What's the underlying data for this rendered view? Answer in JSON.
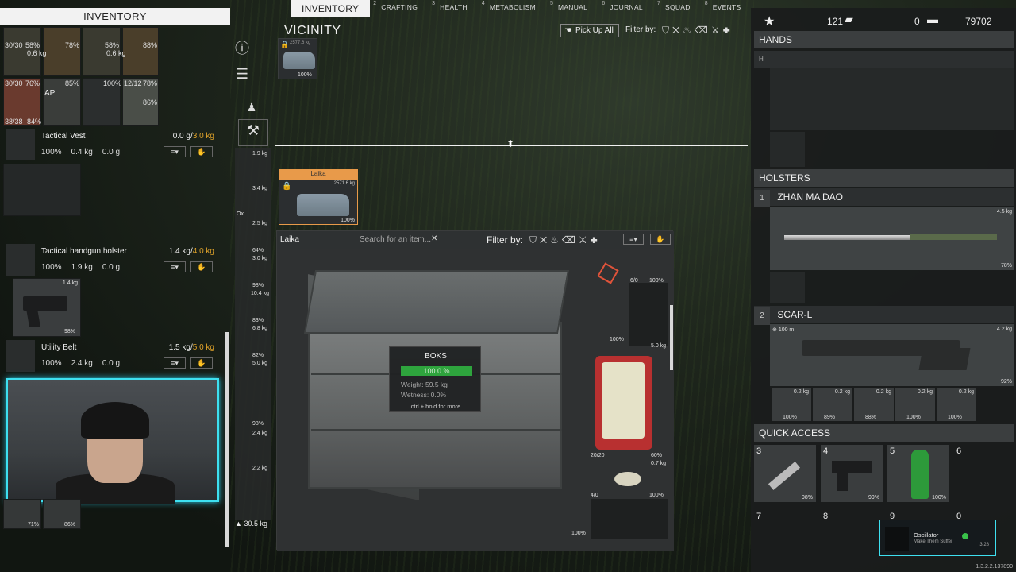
{
  "tabs": [
    {
      "num": "",
      "label": "INVENTORY",
      "active": true
    },
    {
      "num": "2",
      "label": "CRAFTING"
    },
    {
      "num": "3",
      "label": "HEALTH"
    },
    {
      "num": "4",
      "label": "METABOLISM"
    },
    {
      "num": "5",
      "label": "MANUAL"
    },
    {
      "num": "6",
      "label": "JOURNAL"
    },
    {
      "num": "7",
      "label": "SQUAD"
    },
    {
      "num": "8",
      "label": "EVENTS"
    }
  ],
  "inventory": {
    "title": "INVENTORY",
    "top_stack_labels": [
      "30/30",
      "58%",
      "78%",
      "58%",
      "88%",
      "0.6 kg",
      "0.6 kg",
      "30/30",
      "76%",
      "85%",
      "100%",
      "78%",
      "12/12",
      "86%",
      "AP",
      "38/38",
      "84%"
    ],
    "tactical_vest": {
      "name": "Tactical Vest",
      "weight": "0.0 g/",
      "capacity": "3.0 kg",
      "condition": "100%",
      "w1": "0.4 kg",
      "w2": "0.0 g"
    },
    "holster": {
      "name": "Tactical handgun holster",
      "weight": "1.4 kg/",
      "capacity": "4.0 kg",
      "condition": "100%",
      "w1": "1.9 kg",
      "w2": "0.0 g",
      "pistol_weight": "1.4 kg",
      "pistol_pct": "98%"
    },
    "utility_belt": {
      "name": "Utility Belt",
      "weight": "1.5 kg/",
      "capacity": "5.0 kg",
      "condition": "100%",
      "w1": "2.4 kg",
      "w2": "0.0 g"
    },
    "bottom_pct": [
      "71%",
      "86%"
    ]
  },
  "side_column": {
    "weights": [
      "1.9 kg",
      "3.4 kg",
      "Ox",
      "2.5 kg",
      "64%",
      "3.0 kg",
      "98%",
      "10.4 kg",
      "83%",
      "6.8 kg",
      "82%",
      "5.0 kg",
      "98%",
      "2.4 kg",
      "2.2 kg"
    ],
    "total_weight": "30.5 kg"
  },
  "vicinity": {
    "title": "VICINITY",
    "pickup_label": "Pick Up All",
    "filter_label": "Filter by:",
    "car_top": {
      "weight": "2577.6 kg",
      "pct": "100%"
    },
    "laika_card": {
      "name": "Laika",
      "weight": "2571.6 kg",
      "pct": "100%"
    }
  },
  "container": {
    "name": "Laika",
    "search_placeholder": "Search for an item...",
    "filter_label": "Filter by:",
    "grid_labels": [
      "6/0",
      "100%",
      "100%",
      "5.0 kg",
      "20/20",
      "60%",
      "0.7 kg",
      "4/0",
      "100%",
      "100%"
    ]
  },
  "tooltip": {
    "title": "BOKS",
    "condition": "100.0 %",
    "weight": "Weight: 59.5 kg",
    "wetness": "Wetness: 0.0%",
    "hint": "ctrl + hold for more"
  },
  "right_panel": {
    "stats": {
      "star_value": "121",
      "item_value": "0",
      "card_value": "79702"
    },
    "hands": {
      "title": "HANDS",
      "slot": "H"
    },
    "holsters": {
      "title": "HOLSTERS",
      "slot1": {
        "num": "1",
        "name": "ZHAN MA DAO",
        "weight": "4.5 kg",
        "pct": "78%"
      },
      "slot2": {
        "num": "2",
        "name": "SCAR-L",
        "range": "100 m",
        "weight": "4.2 kg",
        "pct": "92%"
      },
      "attachments": [
        {
          "w": "0.2 kg",
          "p": "100%"
        },
        {
          "w": "0.2 kg",
          "p": "89%"
        },
        {
          "w": "0.2 kg",
          "p": "88%"
        },
        {
          "w": "0.2 kg",
          "p": "100%"
        },
        {
          "w": "0.2 kg",
          "p": "100%"
        }
      ]
    },
    "quick_access": {
      "title": "QUICK ACCESS",
      "slots": [
        {
          "num": "3",
          "pct": "98%"
        },
        {
          "num": "4",
          "pct": "99%"
        },
        {
          "num": "5",
          "pct": "100%"
        },
        {
          "num": "6",
          "pct": ""
        },
        {
          "num": "7"
        },
        {
          "num": "8"
        },
        {
          "num": "9"
        },
        {
          "num": "0"
        }
      ]
    }
  },
  "notification": {
    "title": "Oscillator",
    "subtitle": "Make Them Suffer",
    "time": "3:28"
  },
  "version": "1.3.2.2.137890",
  "colors": {
    "accent_green": "#39c24a",
    "warning_orange": "#e0a32a",
    "webcam_cyan": "#3ee0f0",
    "laika_orange": "#e89a4a"
  }
}
